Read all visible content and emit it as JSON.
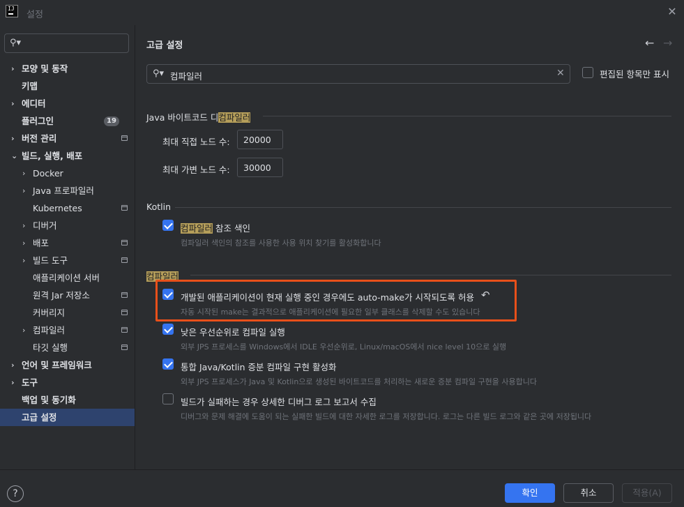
{
  "window": {
    "title": "설정",
    "logo_text": "IJ"
  },
  "sidebar": {
    "items": [
      {
        "label": "모양 및 동작",
        "arrow": "›",
        "bold": true
      },
      {
        "label": "키맵",
        "arrow": "",
        "bold": true
      },
      {
        "label": "에디터",
        "arrow": "›",
        "bold": true
      },
      {
        "label": "플러그인",
        "arrow": "",
        "bold": true,
        "badge": "19"
      },
      {
        "label": "버전 관리",
        "arrow": "›",
        "bold": true,
        "proj": true
      },
      {
        "label": "빌드, 실행, 배포",
        "arrow": "⌄",
        "bold": true
      },
      {
        "label": "Docker",
        "arrow": "›",
        "indent": true
      },
      {
        "label": "Java 프로파일러",
        "arrow": "›",
        "indent": true
      },
      {
        "label": "Kubernetes",
        "arrow": "",
        "indent": true,
        "proj": true
      },
      {
        "label": "디버거",
        "arrow": "›",
        "indent": true
      },
      {
        "label": "배포",
        "arrow": "›",
        "indent": true,
        "proj": true
      },
      {
        "label": "빌드 도구",
        "arrow": "›",
        "indent": true,
        "proj": true
      },
      {
        "label": "애플리케이션 서버",
        "arrow": "",
        "indent": true
      },
      {
        "label": "원격 Jar 저장소",
        "arrow": "",
        "indent": true,
        "proj": true
      },
      {
        "label": "커버리지",
        "arrow": "",
        "indent": true,
        "proj": true
      },
      {
        "label": "컴파일러",
        "arrow": "›",
        "indent": true,
        "proj": true
      },
      {
        "label": "타깃 실행",
        "arrow": "",
        "indent": true,
        "proj": true
      },
      {
        "label": "언어 및 프레임워크",
        "arrow": "›",
        "bold": true
      },
      {
        "label": "도구",
        "arrow": "›",
        "bold": true
      },
      {
        "label": "백업 및 동기화",
        "arrow": "",
        "bold": true
      },
      {
        "label": "고급 설정",
        "arrow": "",
        "bold": true,
        "selected": true
      }
    ]
  },
  "main": {
    "title": "고급 설정",
    "search": {
      "value": "컴파일러"
    },
    "modified_only_label": "편집된 항목만 표시",
    "java_section": {
      "prefix": "Java 바이트코드 디",
      "highlight": "컴파일러"
    },
    "java_fields": [
      {
        "label": "최대 직접 노드 수:",
        "value": "20000"
      },
      {
        "label": "최대 가변 노드 수:",
        "value": "30000"
      }
    ],
    "kotlin_section": "Kotlin",
    "kotlin_option": {
      "label_highlight": "컴파일러",
      "label_rest": " 참조 색인",
      "desc": "컴파일러 색인의 참조를 사용한 사용 위치 찾기를 활성화합니다"
    },
    "compiler_section": "컴파일러",
    "options": [
      {
        "label": "개발된 애플리케이션이 현재 실행 중인 경우에도 auto-make가 시작되도록 허용",
        "desc": "자동 시작된 make는 결과적으로 애플리케이션에 필요한 일부 클래스를 삭제할 수도 있습니다",
        "checked": true
      },
      {
        "label": "낮은 우선순위로 컴파일 실행",
        "desc": "외부 JPS 프로세스를 Windows에서 IDLE 우선순위로, Linux/macOS에서 nice level 10으로 실행",
        "checked": true
      },
      {
        "label": "통합 Java/Kotlin 증분 컴파일 구현 활성화",
        "desc": "외부 JPS 프로세스가 Java 및 Kotlin으로 생성된 바이트코드를 처리하는 새로운 증분 컴파일 구현을 사용합니다",
        "checked": true
      },
      {
        "label": "빌드가 실패하는 경우 상세한 디버그 로그 보고서 수집",
        "desc": "디버그와 문제 해결에 도움이 되는 실패한 빌드에 대한 자세한 로그를 저장합니다. 로그는 다른 빌드 로그와 같은 곳에 저장됩니다",
        "checked": false
      }
    ]
  },
  "footer": {
    "help": "?",
    "ok": "확인",
    "cancel": "취소",
    "apply": "적용(A)"
  },
  "colors": {
    "accent": "#3574f0",
    "highlight": "#b59e5a",
    "callout": "#e8501a"
  }
}
